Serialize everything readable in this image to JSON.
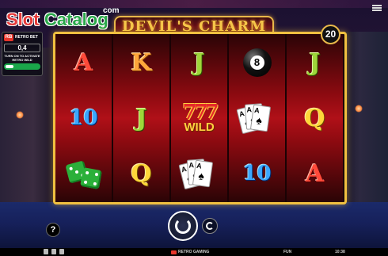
{
  "watermark": {
    "slot": "Slot",
    "catalog": "Catalog",
    "com": "com"
  },
  "title": "DEVIL'S CHARM",
  "lines": "20",
  "retro_bet": {
    "badge": "RB",
    "label": "RETRO BET",
    "value": "0,4",
    "description": "TURN ON TO ACTIVATE RETRO WILD"
  },
  "reels": [
    [
      {
        "kind": "letter",
        "text": "A",
        "color": "red"
      },
      {
        "kind": "letter",
        "text": "10",
        "color": "blue"
      },
      {
        "kind": "dice"
      }
    ],
    [
      {
        "kind": "letter",
        "text": "K",
        "color": "orange"
      },
      {
        "kind": "letter",
        "text": "J",
        "color": "green"
      },
      {
        "kind": "letter",
        "text": "Q",
        "color": "yellow"
      }
    ],
    [
      {
        "kind": "letter",
        "text": "J",
        "color": "green"
      },
      {
        "kind": "wild",
        "sevens": "777",
        "text": "WILD"
      },
      {
        "kind": "cards"
      }
    ],
    [
      {
        "kind": "ball",
        "text": "8"
      },
      {
        "kind": "cards"
      },
      {
        "kind": "letter",
        "text": "10",
        "color": "blue"
      }
    ],
    [
      {
        "kind": "letter",
        "text": "J",
        "color": "green"
      },
      {
        "kind": "letter",
        "text": "Q",
        "color": "yellow"
      },
      {
        "kind": "letter",
        "text": "A",
        "color": "red"
      }
    ]
  ],
  "card_rank": "A",
  "card_suit": "♠",
  "controls": {
    "help": "?"
  },
  "bottom_bar": {
    "brand": "RETRO GAMING",
    "mode": "FUN",
    "clock": "10:38"
  }
}
